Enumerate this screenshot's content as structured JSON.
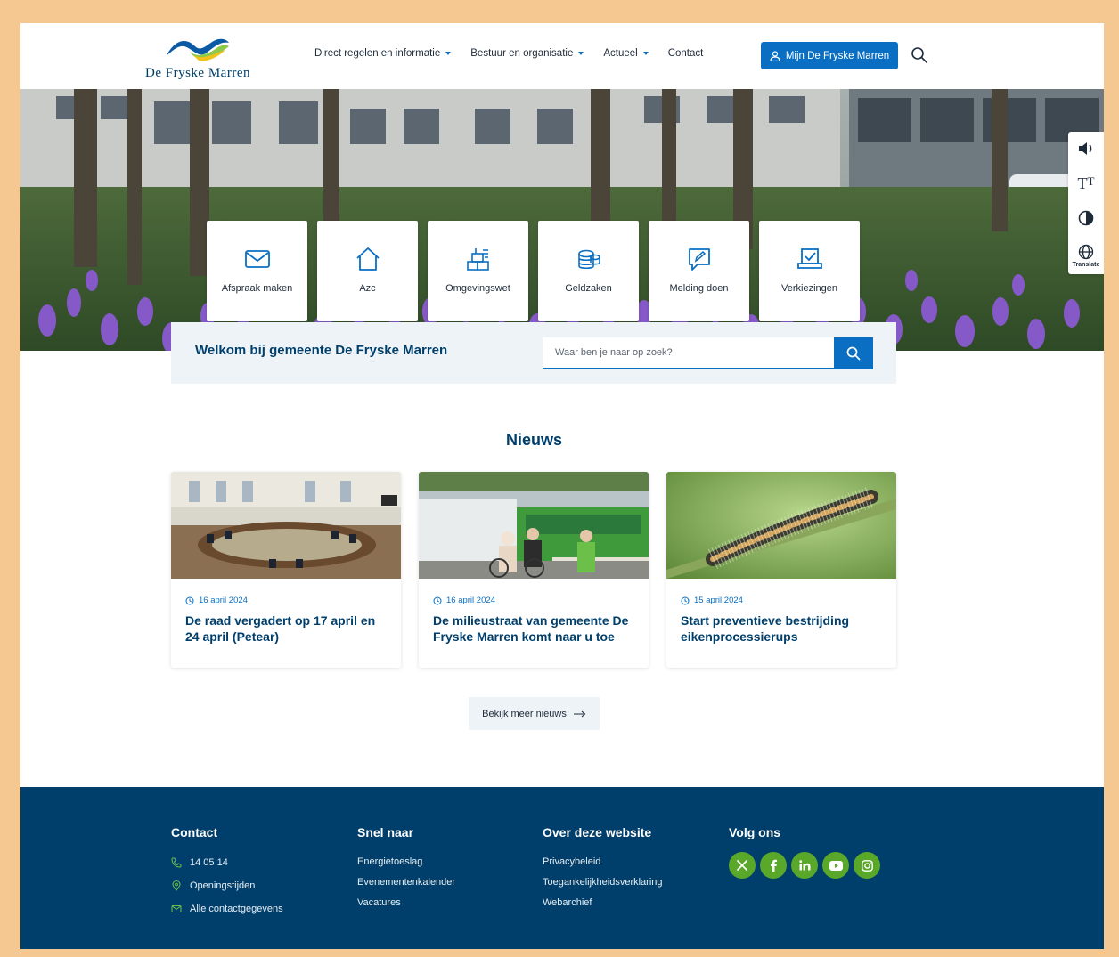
{
  "header": {
    "logo_text": "De Fryske Marren",
    "nav": [
      {
        "label": "Direct regelen en informatie",
        "has_dropdown": true
      },
      {
        "label": "Bestuur en organisatie",
        "has_dropdown": true
      },
      {
        "label": "Actueel",
        "has_dropdown": true
      },
      {
        "label": "Contact",
        "has_dropdown": false
      }
    ],
    "account_button": "Mijn De Fryske Marren"
  },
  "tiles": [
    {
      "label": "Afspraak maken",
      "icon": "envelope-icon"
    },
    {
      "label": "Azc",
      "icon": "house-icon"
    },
    {
      "label": "Omgevingswet",
      "icon": "blocks-icon"
    },
    {
      "label": "Geldzaken",
      "icon": "coins-icon"
    },
    {
      "label": "Melding doen",
      "icon": "chat-pencil-icon"
    },
    {
      "label": "Verkiezingen",
      "icon": "ballot-laptop-icon"
    }
  ],
  "accessibility_bar": {
    "items": [
      "speaker-icon",
      "text-size-icon",
      "contrast-icon",
      "globe-icon"
    ],
    "translate_label": "Translate"
  },
  "welcome": {
    "title": "Welkom bij gemeente De Fryske Marren",
    "search_placeholder": "Waar ben je naar op zoek?"
  },
  "news": {
    "heading": "Nieuws",
    "items": [
      {
        "date": "16 april 2024",
        "title": "De raad vergadert op 17 april en 24 april (Petear)"
      },
      {
        "date": "16 april 2024",
        "title": "De milieustraat van gemeente De Fryske Marren komt naar u toe"
      },
      {
        "date": "15 april 2024",
        "title": "Start preventieve bestrijding eikenprocessierups"
      }
    ],
    "more_button": "Bekijk meer nieuws"
  },
  "footer": {
    "contact": {
      "heading": "Contact",
      "items": [
        {
          "label": "14 05 14",
          "icon": "phone-icon"
        },
        {
          "label": "Openingstijden",
          "icon": "location-pin-icon"
        },
        {
          "label": "Alle contactgegevens",
          "icon": "envelope-icon"
        }
      ]
    },
    "snel_naar": {
      "heading": "Snel naar",
      "items": [
        "Energietoeslag",
        "Evenementenkalender",
        "Vacatures"
      ]
    },
    "over": {
      "heading": "Over deze website",
      "items": [
        "Privacybeleid",
        "Toegankelijkheidsverklaring",
        "Webarchief"
      ]
    },
    "volg": {
      "heading": "Volg ons",
      "socials": [
        "x-icon",
        "facebook-icon",
        "linkedin-icon",
        "youtube-icon",
        "instagram-icon"
      ]
    }
  },
  "colors": {
    "primary_blue": "#0a6fc2",
    "dark_navy": "#003f6b",
    "social_green": "#5aa82a",
    "frame_orange": "#f5c892"
  }
}
